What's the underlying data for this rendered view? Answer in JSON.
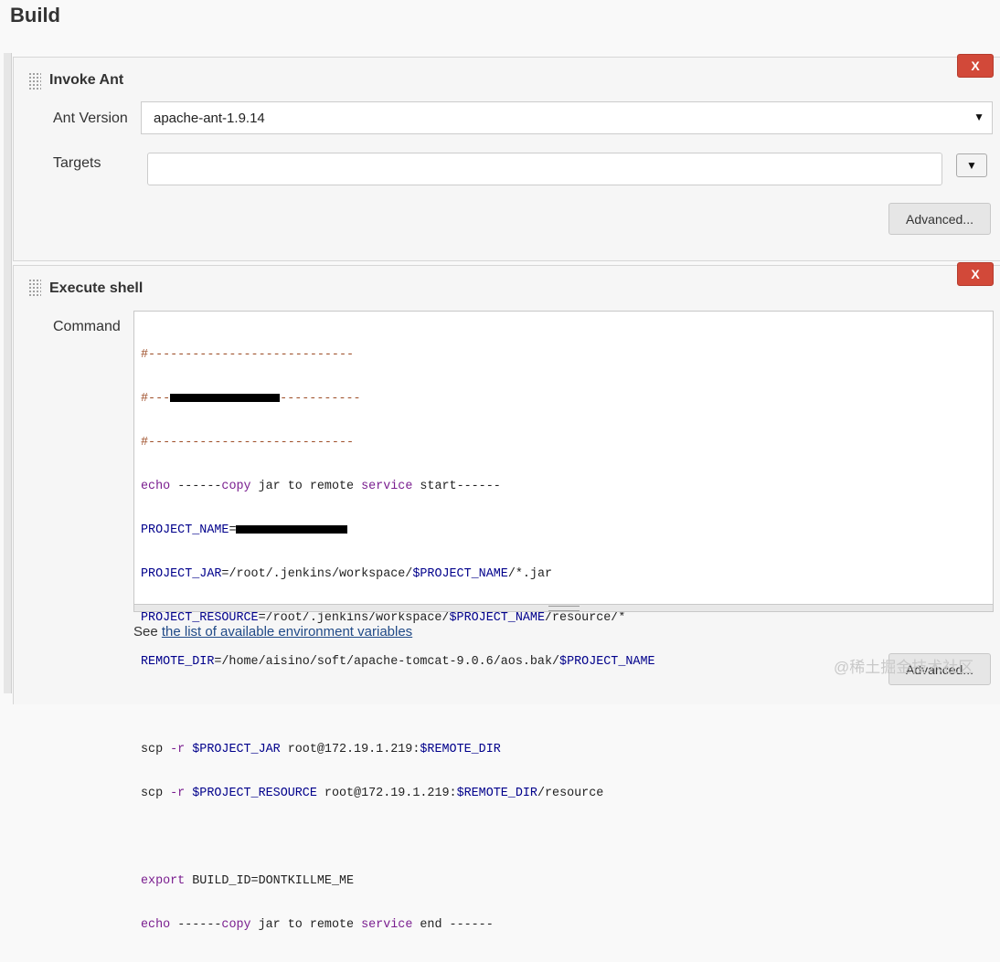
{
  "page": {
    "title": "Build"
  },
  "invoke_ant": {
    "title": "Invoke Ant",
    "delete_label": "X",
    "ant_version_label": "Ant Version",
    "ant_version_value": "apache-ant-1.9.14",
    "targets_label": "Targets",
    "targets_value": "",
    "expand_icon": "▼",
    "advanced_label": "Advanced..."
  },
  "execute_shell": {
    "title": "Execute shell",
    "delete_label": "X",
    "command_label": "Command",
    "code": {
      "l1": "#----------------------------",
      "l2a": "#---",
      "l2b": "-----------",
      "l3": "#----------------------------",
      "l4_cmd": "echo",
      "l4_a": " ------",
      "l4_b": "copy",
      "l4_c": " jar to remote ",
      "l4_d": "service",
      "l4_e": " start",
      "l4_f": "------",
      "l5_var": "PROJECT_NAME",
      "l5_eq": "=",
      "l6_var": "PROJECT_JAR",
      "l6_a": "=/root/.jenkins/workspace/",
      "l6_b": "$PROJECT_NAME",
      "l6_c": "/*.jar",
      "l7_var": "PROJECT_RESOURCE",
      "l7_a": "=/root/.jenkins/workspace/",
      "l7_b": "$PROJECT_NAME",
      "l7_c": "/resource/*",
      "l8_var": "REMOTE_DIR",
      "l8_a": "=/home/aisino/soft/apache-tomcat-9.0.6/aos.bak/",
      "l8_b": "$PROJECT_NAME",
      "l9_cmd": "scp",
      "l9_flag": " -r ",
      "l9_a": "$PROJECT_JAR",
      "l9_b": " root@172.19.1.219:",
      "l9_c": "$REMOTE_DIR",
      "l10_cmd": "scp",
      "l10_flag": " -r ",
      "l10_a": "$PROJECT_RESOURCE",
      "l10_b": " root@172.19.1.219:",
      "l10_c": "$REMOTE_DIR",
      "l10_d": "/resource",
      "l11_cmd": "export",
      "l11_var": " BUILD_ID",
      "l11_a": "=DONTKILLME_ME",
      "l12_cmd": "echo",
      "l12_a": " ------",
      "l12_b": "copy",
      "l12_c": " jar to remote ",
      "l12_d": "service",
      "l12_e": " end ------"
    },
    "see_prefix": "See ",
    "env_link": "the list of available environment variables",
    "advanced_label": "Advanced..."
  },
  "watermark": "@稀土掘金技术社区",
  "colors": {
    "delete_red": "#d24939",
    "link_blue": "#204a87"
  }
}
